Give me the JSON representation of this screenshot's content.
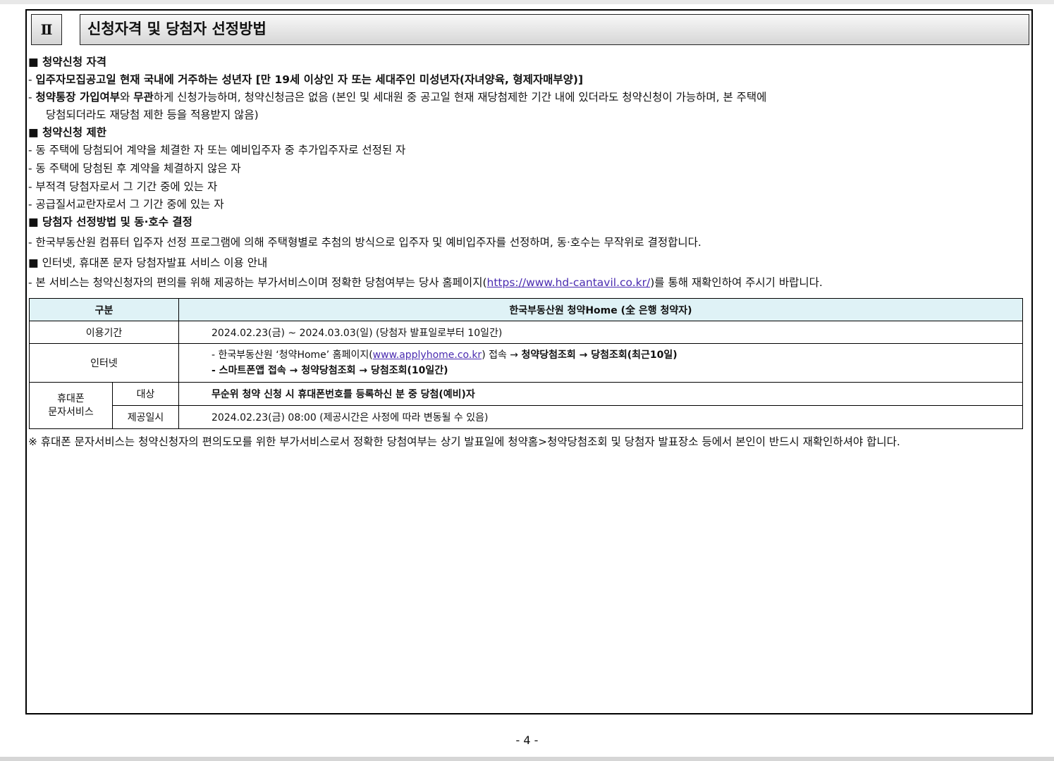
{
  "section": {
    "number": "Ⅱ",
    "title": "신청자격 및 당첨자 선정방법"
  },
  "qualification": {
    "heading": "■ 청약신청 자격",
    "l1_prefix": "- ",
    "l1_bold": "입주자모집공고일 현재 국내에 거주하는 성년자 [만 19세 이상인 자 또는 세대주인 미성년자(자녀양육, 형제자매부양)]",
    "l2_prefix": "- ",
    "l2_b1": "청약통장 가입여부",
    "l2_t1": "와 ",
    "l2_b2": "무관",
    "l2_t2": "하게 신청가능하며, 청약신청금은 없음 (본인 및 세대원 중 공고일 현재 재당첨제한 기간 내에 있더라도 청약신청이 가능하며, 본 주택에",
    "l2_cont": "당첨되더라도 재당첨 제한 등을 적용받지 않음)"
  },
  "restriction": {
    "heading": "■ 청약신청 제한",
    "items": [
      "- 동 주택에 당첨되어 계약을 체결한 자 또는 예비입주자 중 추가입주자로 선정된 자",
      "- 동 주택에 당첨된 후 계약을 체결하지 않은 자",
      "- 부적격 당첨자로서 그 기간 중에 있는 자",
      "- 공급질서교란자로서 그 기간 중에 있는 자"
    ]
  },
  "selection": {
    "heading": "■ 당첨자 선정방법 및 동·호수 결정",
    "text": "- 한국부동산원 컴퓨터 입주자 선정 프로그램에 의해 주택형별로 추첨의 방식으로 입주자 및 예비입주자를 선정하며, 동·호수는 무작위로 결정합니다."
  },
  "sms": {
    "heading": "■ 인터넷, 휴대폰 문자 당첨자발표 서비스 이용 안내",
    "pre": "- 본 서비스는 청약신청자의 편의를 위해 제공하는 부가서비스이며 정확한 당첨여부는 당사 홈페이지(",
    "url": "https://www.hd-cantavil.co.kr/",
    "post": ")를 통해 재확인하여 주시기 바랍니다."
  },
  "table": {
    "h_col1": "구분",
    "h_col2": "한국부동산원 청약Home (全 은행 청약자)",
    "period_label": "이용기간",
    "period_value": "2024.02.23(금) ~ 2024.03.03(일) (당첨자 발표일로부터 10일간)",
    "internet_label": "인터넷",
    "internet_l1_pre": "- 한국부동산원 ‘청약Home’ 홈페이지(",
    "internet_l1_url": "www.applyhome.co.kr",
    "internet_l1_mid": ") 접속 → ",
    "internet_l1_bold": "청약당첨조회 → 당첨조회(최근10일)",
    "internet_l2_bold": "- 스마트폰앱 접속 → 청약당첨조회 → 당첨조회(10일간)",
    "mobile_label_1": "휴대폰",
    "mobile_label_2": "문자서비스",
    "target_label": "대상",
    "target_value": "무순위 청약 신청 시 휴대폰번호를 등록하신 분 중 당첨(예비)자",
    "time_label": "제공일시",
    "time_value": "2024.02.23(금) 08:00 (제공시간은 사정에 따라 변동될 수 있음)"
  },
  "note": "※ 휴대폰 문자서비스는 청약신청자의 편의도모를 위한 부가서비스로서 정확한 당첨여부는 상기 발표일에 청약홈>청약당첨조회 및 당첨자 발표장소 등에서 본인이 반드시 재확인하셔야 합니다.",
  "page_number": "- 4 -"
}
